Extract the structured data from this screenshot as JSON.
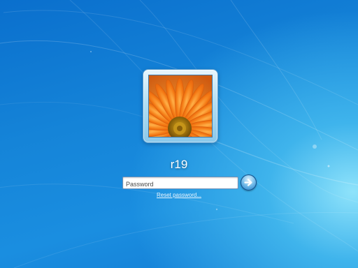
{
  "login": {
    "username": "r19",
    "password_placeholder": "Password",
    "password_value": "",
    "reset_link": "Reset password..."
  },
  "icons": {
    "account_picture": "orange-gerbera-flower-icon",
    "submit": "arrow-right-icon"
  },
  "colors": {
    "background": "#1584d8",
    "glow": "#8fe3fb",
    "flower": "#f07a1a",
    "text": "#ffffff"
  }
}
